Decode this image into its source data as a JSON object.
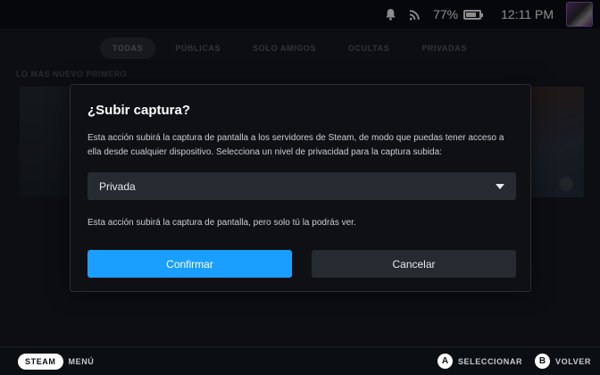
{
  "status_bar": {
    "icons": [
      "bell-icon",
      "wifi-icon"
    ],
    "battery_percent": "77%",
    "battery_level": 0.77,
    "clock": "12:11 PM"
  },
  "background": {
    "tabs": [
      {
        "label": "TODAS",
        "active": true
      },
      {
        "label": "PÚBLICAS",
        "active": false
      },
      {
        "label": "SOLO AMIGOS",
        "active": false
      },
      {
        "label": "OCULTAS",
        "active": false
      },
      {
        "label": "PRIVADAS",
        "active": false
      }
    ],
    "section_label": "LO MÁS NUEVO PRIMERO"
  },
  "dialog": {
    "title": "¿Subir captura?",
    "description": "Esta acción subirá la captura de pantalla a los servidores de Steam, de modo que puedas tener acceso a ella desde cualquier dispositivo. Selecciona un nivel de privacidad para la captura subida:",
    "privacy_select": {
      "value": "Privada"
    },
    "note": "Esta acción subirá la captura de pantalla, pero solo tú la podrás ver.",
    "confirm_label": "Confirmar",
    "cancel_label": "Cancelar"
  },
  "footer": {
    "steam_label": "STEAM",
    "menu_label": "MENÚ",
    "a_glyph": "A",
    "select_label": "SELECCIONAR",
    "b_glyph": "B",
    "back_label": "VOLVER"
  },
  "colors": {
    "accent": "#1a9fff",
    "dialog_bg": "#0e1014",
    "control_bg": "#262a31"
  }
}
